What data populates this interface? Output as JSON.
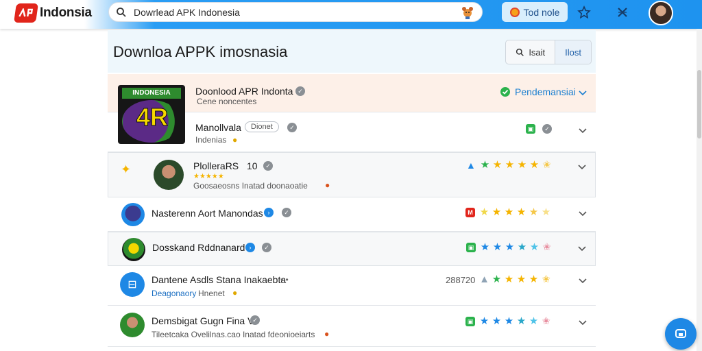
{
  "app": {
    "logo_text": "Indonsia"
  },
  "search": {
    "value": "Dowrlead APK Indonesia"
  },
  "topbar": {
    "pill_label": "Tod nole"
  },
  "page": {
    "title": "Downloa APPK imosnasia",
    "btn_edit": "Isait",
    "btn_post": "Ilost"
  },
  "thumb": {
    "banner": "INDONESIA",
    "big": "4R"
  },
  "rows": [
    {
      "name": "Doonlood APR Indonta",
      "sub": "Cene noncentes",
      "status": "Pendemansiai"
    },
    {
      "name": "Manollvala",
      "tag": "Dionet",
      "sub": "Indenias"
    },
    {
      "name": "PlolleraRS",
      "count": "10",
      "sub": "Goosaeosns Inatad doonaoatie"
    },
    {
      "name": "Nasterenn Aort Manondas"
    },
    {
      "name": "Dosskand Rddnanard"
    },
    {
      "name": "Dantene Asdls Stana Inakaebta",
      "dash": "• •",
      "number": "288720",
      "sub": "Deagonaory",
      "sub2": "Hnenet"
    },
    {
      "name": "Demsbigat Gugn Fina V",
      "sub": "Tileetcaka Ovelilnas.cao Inatad fdeonioeiarts"
    }
  ],
  "colors": {
    "accent": "#1e93ef",
    "star": "#f5b400",
    "brand_red": "#e1251b",
    "green": "#2bb24c"
  },
  "icons": [
    "search-icon",
    "mascot-icon",
    "star-outline-icon",
    "close-x-icon",
    "check-badge-icon",
    "chevron-down-icon",
    "star-icon",
    "chat-icon"
  ]
}
